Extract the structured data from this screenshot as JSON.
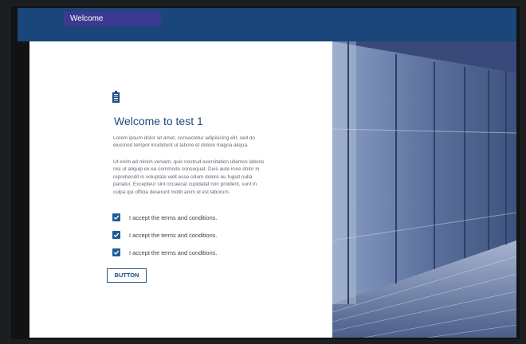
{
  "header": {
    "tab_label": "Welcome"
  },
  "main": {
    "title": "Welcome to test 1",
    "paragraph1": "Lorem ipsum dolor sit amet, consectetur adipisicing elit, sed do eiusmod tempor incididunt ut labore et dolore magna aliqua.",
    "paragraph2": "Ut enim ad minim veniam, quis nostrud exercitation ullamco laboris nisi ut aliquip ex ea commodo consequat. Duis aute irure dolor in reprehendit in voluptate velit esse cillum dolore eu fugiat nulla pariatur. Excepteur sint occaecat cupidatat non proident, sunt in culpa qui officia deserunt mollit anim id est laborum.",
    "checkboxes": [
      {
        "label": "I accept the terms and conditions.",
        "checked": true
      },
      {
        "label": "I accept the terms and conditions.",
        "checked": true
      },
      {
        "label": "I accept the terms and conditions.",
        "checked": true
      }
    ],
    "button_label": "BUTTON"
  },
  "icons": {
    "logo": "building-icon",
    "checkbox": "checkmark-icon"
  },
  "colors": {
    "header_bar": "#1a4679",
    "tab": "#3c3a90",
    "title": "#1b4c80",
    "checkbox": "#1d5e98",
    "frame": "#1c1d1f"
  }
}
